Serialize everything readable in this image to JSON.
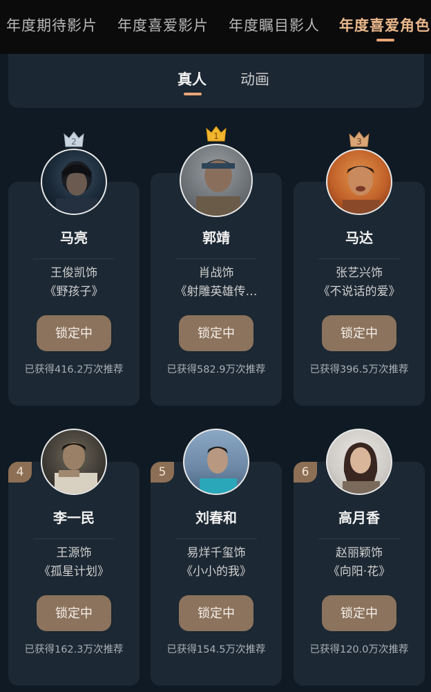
{
  "top_tabs": [
    {
      "label": "年度期待影片",
      "active": false
    },
    {
      "label": "年度喜爱影片",
      "active": false
    },
    {
      "label": "年度瞩目影人",
      "active": false
    },
    {
      "label": "年度喜爱角色",
      "active": true
    }
  ],
  "sub_tabs": [
    {
      "label": "真人",
      "active": true
    },
    {
      "label": "动画",
      "active": false
    }
  ],
  "cards": [
    {
      "rank": "2",
      "character": "马亮",
      "actor": "王俊凯饰",
      "movie": "《野孩子》",
      "button": "锁定中",
      "count": "已获得416.2万次推荐"
    },
    {
      "rank": "1",
      "character": "郭靖",
      "actor": "肖战饰",
      "movie": "《射雕英雄传…",
      "button": "锁定中",
      "count": "已获得582.9万次推荐"
    },
    {
      "rank": "3",
      "character": "马达",
      "actor": "张艺兴饰",
      "movie": "《不说话的爱》",
      "button": "锁定中",
      "count": "已获得396.5万次推荐"
    },
    {
      "rank": "4",
      "character": "李一民",
      "actor": "王源饰",
      "movie": "《孤星计划》",
      "button": "锁定中",
      "count": "已获得162.3万次推荐"
    },
    {
      "rank": "5",
      "character": "刘春和",
      "actor": "易烊千玺饰",
      "movie": "《小小的我》",
      "button": "锁定中",
      "count": "已获得154.5万次推荐"
    },
    {
      "rank": "6",
      "character": "高月香",
      "actor": "赵丽颖饰",
      "movie": "《向阳·花》",
      "button": "锁定中",
      "count": "已获得120.0万次推荐"
    }
  ],
  "colors": {
    "accent": "#e9a577",
    "button": "#8c735d",
    "card": "#1c2833",
    "background": "#0f1a24"
  }
}
